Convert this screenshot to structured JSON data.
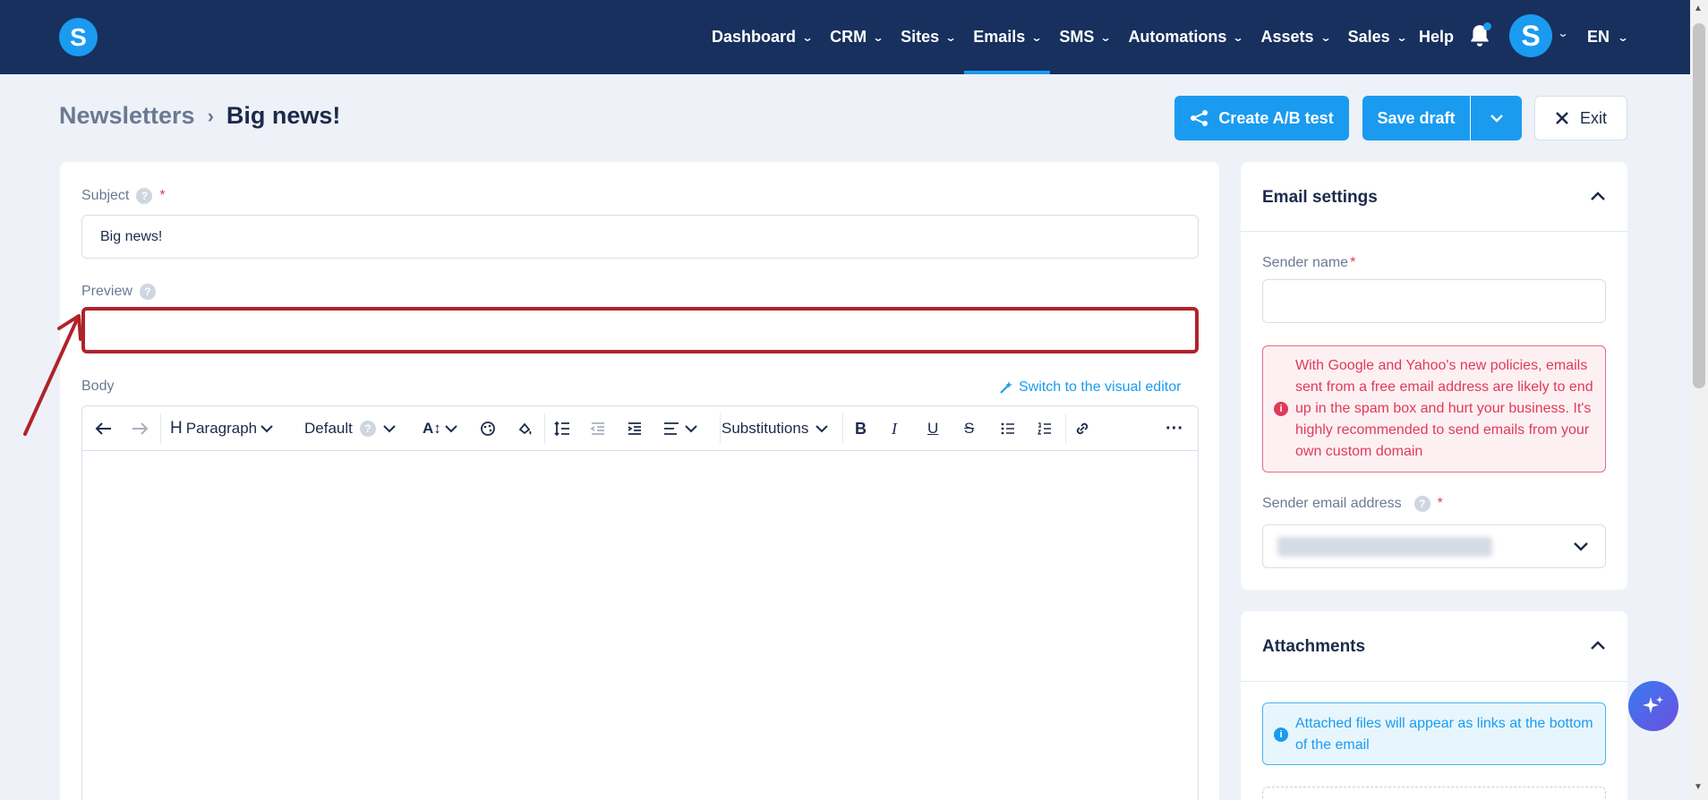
{
  "nav": {
    "items": [
      {
        "label": "Dashboard",
        "active": false
      },
      {
        "label": "CRM",
        "active": false
      },
      {
        "label": "Sites",
        "active": false
      },
      {
        "label": "Emails",
        "active": true
      },
      {
        "label": "SMS",
        "active": false
      },
      {
        "label": "Automations",
        "active": false
      },
      {
        "label": "Assets",
        "active": false
      },
      {
        "label": "Sales",
        "active": false
      }
    ],
    "help": "Help",
    "language": "EN",
    "logo_letter": "S",
    "avatar_letter": "S"
  },
  "breadcrumb": {
    "parent": "Newsletters",
    "current": "Big news!"
  },
  "actions": {
    "ab_test": "Create A/B test",
    "save_draft": "Save draft",
    "exit": "Exit"
  },
  "form": {
    "subject_label": "Subject",
    "subject_value": "Big news!",
    "preview_label": "Preview",
    "preview_value": "",
    "body_label": "Body",
    "visual_editor_link": "Switch to the visual editor"
  },
  "toolbar": {
    "paragraph": "Paragraph",
    "font": "Default",
    "substitutions": "Substitutions"
  },
  "email_settings": {
    "title": "Email settings",
    "sender_name_label": "Sender name",
    "sender_name_value": "",
    "warning": "With Google and Yahoo's new policies, emails sent from a free email address are likely to end up in the spam box and hurt your business. It's highly recommended to send emails from your own custom domain",
    "sender_email_label": "Sender email address"
  },
  "attachments": {
    "title": "Attachments",
    "info": "Attached files will appear as links at the bottom of the email"
  },
  "colors": {
    "nav_bg": "#17305e",
    "accent": "#1a9bf0",
    "highlight": "#b0232a",
    "danger": "#e03a5a"
  }
}
